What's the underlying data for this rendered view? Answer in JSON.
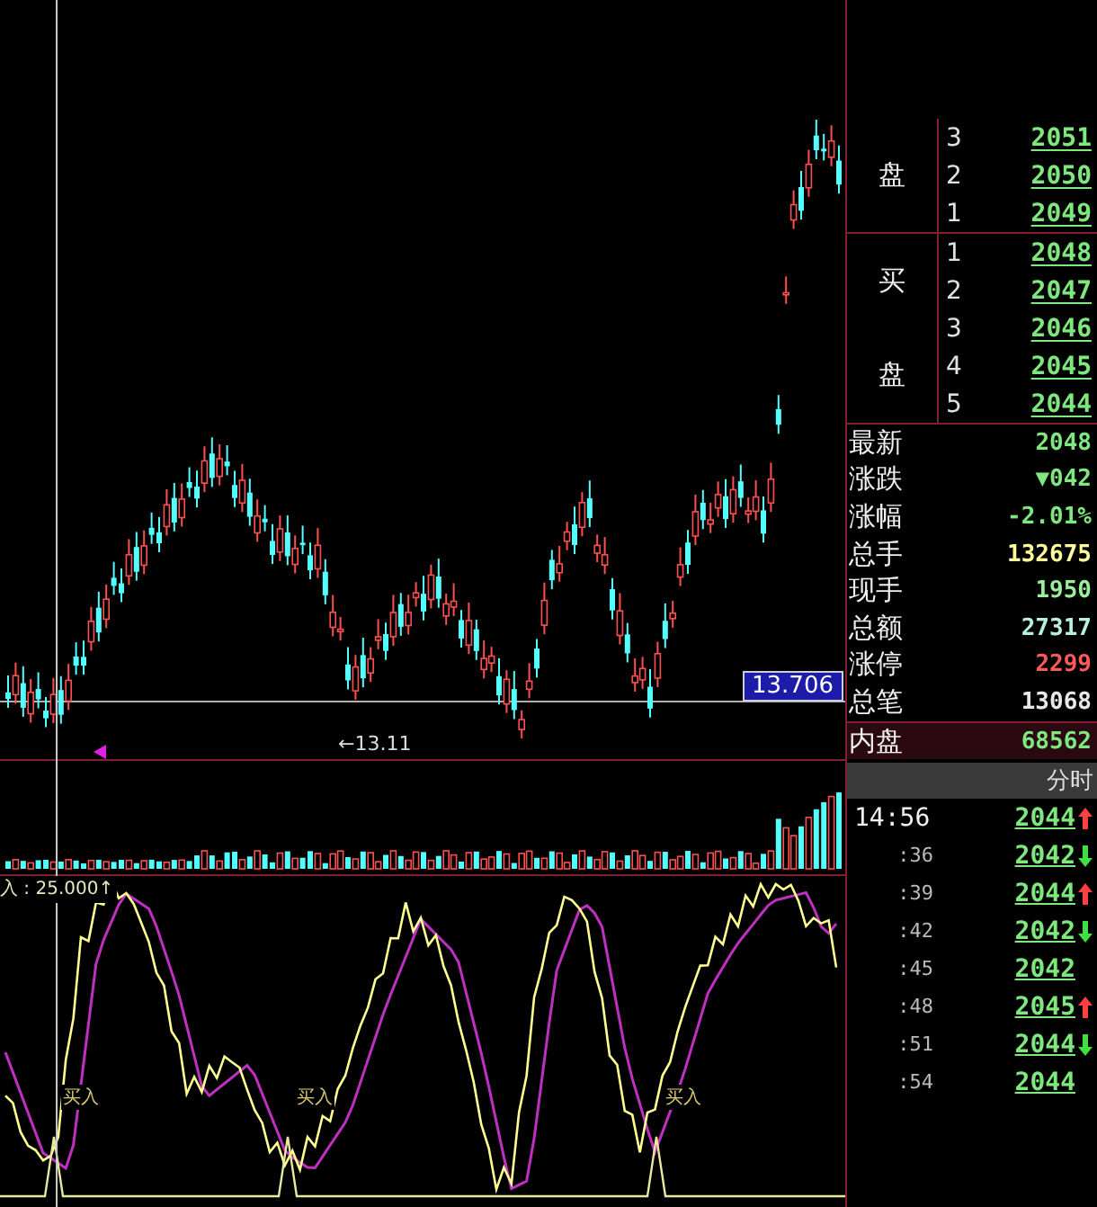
{
  "chart": {
    "price_marker": "13.706",
    "low_label": "←13.11",
    "indicator_label": "入 : 25.000↑",
    "buy_signals": [
      "买入",
      "买入",
      "买入"
    ]
  },
  "sell_book": {
    "label_chars": [
      "盘"
    ],
    "levels": [
      {
        "level": "3",
        "price": "2051"
      },
      {
        "level": "2",
        "price": "2050"
      },
      {
        "level": "1",
        "price": "2049"
      }
    ]
  },
  "buy_book": {
    "label_chars": [
      "买",
      "盘"
    ],
    "levels": [
      {
        "level": "1",
        "price": "2048"
      },
      {
        "level": "2",
        "price": "2047"
      },
      {
        "level": "3",
        "price": "2046"
      },
      {
        "level": "4",
        "price": "2045"
      },
      {
        "level": "5",
        "price": "2044"
      }
    ]
  },
  "stats": [
    {
      "label": "最新",
      "value": "2048",
      "color": "#7ee87e",
      "highlighted": false
    },
    {
      "label": "涨跌",
      "value": "▼042",
      "color": "#7ee87e",
      "highlighted": false
    },
    {
      "label": "涨幅",
      "value": "-2.01%",
      "color": "#7ee87e",
      "highlighted": false
    },
    {
      "label": "总手",
      "value": "132675",
      "color": "#ffff9a",
      "highlighted": false
    },
    {
      "label": "现手",
      "value": "1950",
      "color": "#9af09a",
      "highlighted": false
    },
    {
      "label": "总额",
      "value": "27317",
      "color": "#b8f0e0",
      "highlighted": false
    },
    {
      "label": "涨停",
      "value": "2299",
      "color": "#ff5a5a",
      "highlighted": false
    },
    {
      "label": "总笔",
      "value": "13068",
      "color": "#e8e8e8",
      "highlighted": false
    },
    {
      "label": "内盘",
      "value": "68562",
      "color": "#7ee87e",
      "highlighted": true
    }
  ],
  "ticks_header": "分时",
  "ticks": [
    {
      "time": "14:56",
      "price": "2044",
      "kind": "up"
    },
    {
      "time": ":36",
      "price": "2042",
      "kind": "down"
    },
    {
      "time": ":39",
      "price": "2044",
      "kind": "up"
    },
    {
      "time": ":42",
      "price": "2042",
      "kind": "down"
    },
    {
      "time": ":45",
      "price": "2042",
      "kind": "flat"
    },
    {
      "time": ":48",
      "price": "2045",
      "kind": "up"
    },
    {
      "time": ":51",
      "price": "2044",
      "kind": "down"
    },
    {
      "time": ":54",
      "price": "2044",
      "kind": "flat"
    }
  ]
}
